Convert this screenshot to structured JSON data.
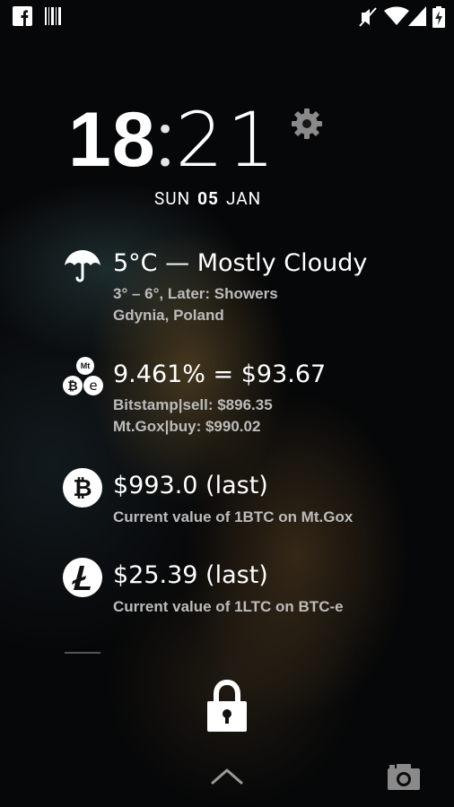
{
  "clock": {
    "hours": "18",
    "separator": ":",
    "minutes": "21"
  },
  "date": {
    "day": "SUN",
    "date": "05",
    "month": "JAN"
  },
  "weather": {
    "main": "5°C — Mostly Cloudy",
    "detail": "3° – 6°, Later: Showers",
    "location": "Gdynia, Poland"
  },
  "exchange": {
    "main": "9.461% = $93.67",
    "line1": "Bitstamp|sell: $896.35",
    "line2": "Mt.Gox|buy: $990.02",
    "icon_label": "Mt"
  },
  "bitcoin": {
    "main": "$993.0 (last)",
    "sub": "Current value of 1BTC on Mt.Gox"
  },
  "litecoin": {
    "main": "$25.39 (last)",
    "sub": "Current value of 1LTC on BTC-e"
  },
  "icons": {
    "status_left": [
      "facebook-icon",
      "barcode-icon"
    ],
    "status_right": [
      "mute-icon",
      "wifi-icon",
      "signal-icon",
      "battery-charging-icon"
    ],
    "lock": "lock-icon",
    "unlock": "chevron-up-icon",
    "camera": "camera-icon",
    "settings": "gear-icon"
  }
}
